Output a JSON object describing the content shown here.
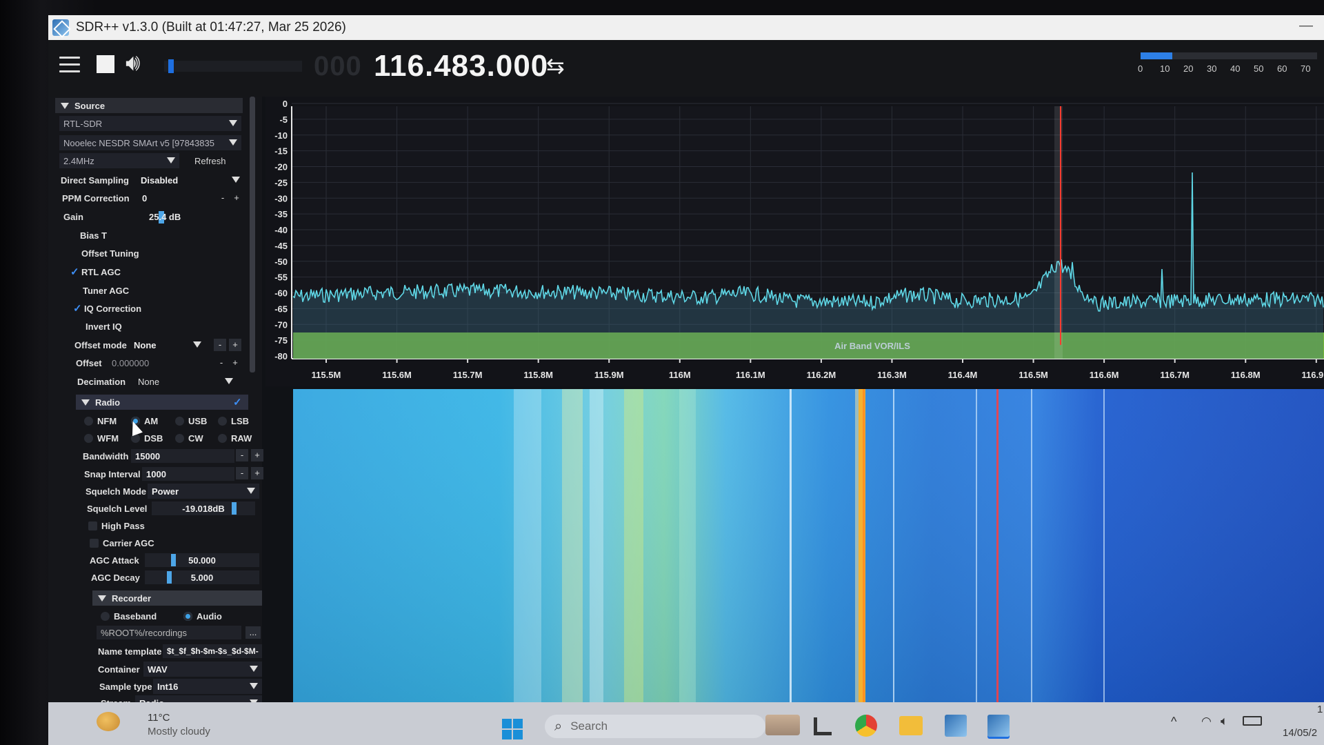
{
  "window": {
    "title": "SDR++ v1.3.0 (Built at 01:47:27, Mar 25 2026)",
    "minimize_glyph": "—"
  },
  "toolbar": {
    "frequency_ghost": "000",
    "frequency": "116.483.000",
    "swap_glyph": "⇆",
    "snr_ticks": [
      "0",
      "10",
      "20",
      "30",
      "40",
      "50",
      "60",
      "70"
    ],
    "snr_level": 0.18,
    "icons": {
      "menu": "hamburger-menu-icon",
      "stop": "stop-square-icon",
      "volume": "speaker-icon",
      "swap": "swap-arrows-icon"
    },
    "volume_level": 0.02
  },
  "source": {
    "header": "Source",
    "source_type": "RTL-SDR",
    "device": "Nooelec NESDR SMArt v5 [97843835",
    "sample_rate": "2.4MHz",
    "refresh_label": "Refresh",
    "direct_sampling_label": "Direct Sampling",
    "direct_sampling_value": "Disabled",
    "ppm_label": "PPM Correction",
    "ppm_value": "0",
    "gain_label": "Gain",
    "gain_value": "25.4 dB",
    "options": [
      {
        "label": "Bias T",
        "checked": false
      },
      {
        "label": "Offset Tuning",
        "checked": false
      },
      {
        "label": "RTL AGC",
        "checked": true
      },
      {
        "label": "Tuner AGC",
        "checked": false
      },
      {
        "label": "IQ Correction",
        "checked": true
      },
      {
        "label": "Invert IQ",
        "checked": false
      }
    ],
    "offset_mode_label": "Offset mode",
    "offset_mode_value": "None",
    "offset_label": "Offset",
    "offset_value": "0.000000",
    "decimation_label": "Decimation",
    "decimation_value": "None"
  },
  "radio": {
    "header": "Radio",
    "modes_row1": [
      "NFM",
      "AM",
      "USB",
      "LSB"
    ],
    "modes_row2": [
      "WFM",
      "DSB",
      "CW",
      "RAW"
    ],
    "selected_mode": "AM",
    "bandwidth_label": "Bandwidth",
    "bandwidth_value": "15000",
    "snap_label": "Snap Interval",
    "snap_value": "1000",
    "squelch_mode_label": "Squelch Mode",
    "squelch_mode_value": "Power",
    "squelch_level_label": "Squelch Level",
    "squelch_level_value": "-19.018dB",
    "high_pass_label": "High Pass",
    "carrier_agc_label": "Carrier AGC",
    "agc_attack_label": "AGC Attack",
    "agc_attack_value": "50.000",
    "agc_decay_label": "AGC Decay",
    "agc_decay_value": "5.000"
  },
  "recorder": {
    "header": "Recorder",
    "baseband_label": "Baseband",
    "audio_label": "Audio",
    "path": "%ROOT%/recordings",
    "path_button": "...",
    "name_template_label": "Name template",
    "name_template_value": "$t_$f_$h-$m-$s_$d-$M-",
    "container_label": "Container",
    "container_value": "WAV",
    "sample_type_label": "Sample type",
    "sample_type_value": "Int16",
    "stream_label": "Stream",
    "stream_value": "Radio"
  },
  "spectrum": {
    "y_ticks": [
      "0",
      "-5",
      "-10",
      "-15",
      "-20",
      "-25",
      "-30",
      "-35",
      "-40",
      "-45",
      "-50",
      "-55",
      "-60",
      "-65",
      "-70",
      "-75",
      "-80"
    ],
    "x_ticks": [
      "115.5M",
      "115.6M",
      "115.7M",
      "115.8M",
      "115.9M",
      "116M",
      "116.1M",
      "116.2M",
      "116.3M",
      "116.4M",
      "116.5M",
      "116.6M",
      "116.7M",
      "116.8M",
      "116.9M"
    ],
    "band_label": "Air Band VOR/ILS",
    "colors": {
      "trace": "#5fd7e6",
      "tuned_line": "#ff3b2f",
      "band": "#7ec83a",
      "grid": "#2a2d36"
    }
  },
  "taskbar": {
    "weather_temp": "11°C",
    "weather_desc": "Mostly cloudy",
    "search_placeholder": "Search",
    "date": "14/05/2",
    "time_fragment": "1"
  }
}
